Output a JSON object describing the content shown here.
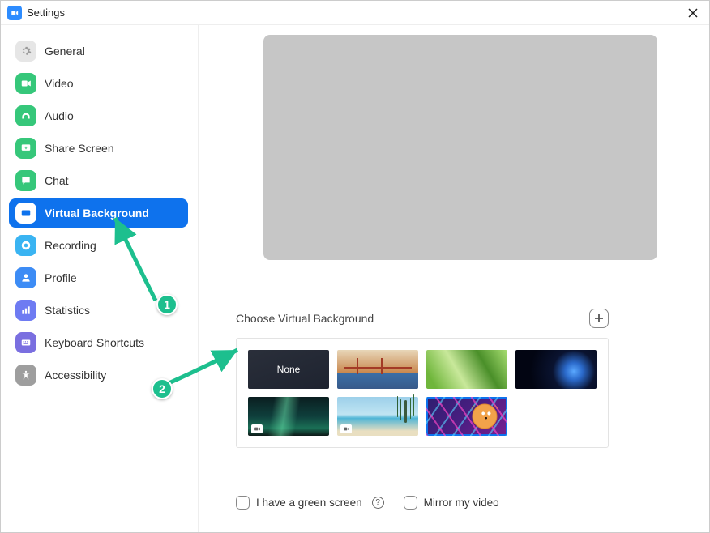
{
  "window": {
    "title": "Settings"
  },
  "sidebar": {
    "items": [
      {
        "key": "general",
        "label": "General",
        "iconBg": "#e6e6e6"
      },
      {
        "key": "video",
        "label": "Video",
        "iconBg": "#36C77A"
      },
      {
        "key": "audio",
        "label": "Audio",
        "iconBg": "#36C77A"
      },
      {
        "key": "share",
        "label": "Share Screen",
        "iconBg": "#36C77A"
      },
      {
        "key": "chat",
        "label": "Chat",
        "iconBg": "#36C77A"
      },
      {
        "key": "vbg",
        "label": "Virtual Background",
        "iconBg": "#ffffff",
        "selected": true
      },
      {
        "key": "recording",
        "label": "Recording",
        "iconBg": "#3AB4F2"
      },
      {
        "key": "profile",
        "label": "Profile",
        "iconBg": "#3D8CF5"
      },
      {
        "key": "stats",
        "label": "Statistics",
        "iconBg": "#6E7BF2"
      },
      {
        "key": "shortcuts",
        "label": "Keyboard Shortcuts",
        "iconBg": "#7A6FE0"
      },
      {
        "key": "a11y",
        "label": "Accessibility",
        "iconBg": "#9E9E9E"
      }
    ]
  },
  "main": {
    "chooseLabel": "Choose Virtual Background",
    "thumbs": [
      {
        "key": "none",
        "label": "None"
      },
      {
        "key": "bridge",
        "label": "Golden Gate Bridge"
      },
      {
        "key": "grass",
        "label": "Grass"
      },
      {
        "key": "earth",
        "label": "Earth from space"
      },
      {
        "key": "aurora",
        "label": "Aurora",
        "video": true
      },
      {
        "key": "beach",
        "label": "Beach",
        "video": true
      },
      {
        "key": "tiger",
        "label": "Neon Tiger",
        "selected": true
      }
    ],
    "footer": {
      "greenScreen": "I have a green screen",
      "mirror": "Mirror my video"
    }
  },
  "annotations": {
    "one": "1",
    "two": "2"
  }
}
